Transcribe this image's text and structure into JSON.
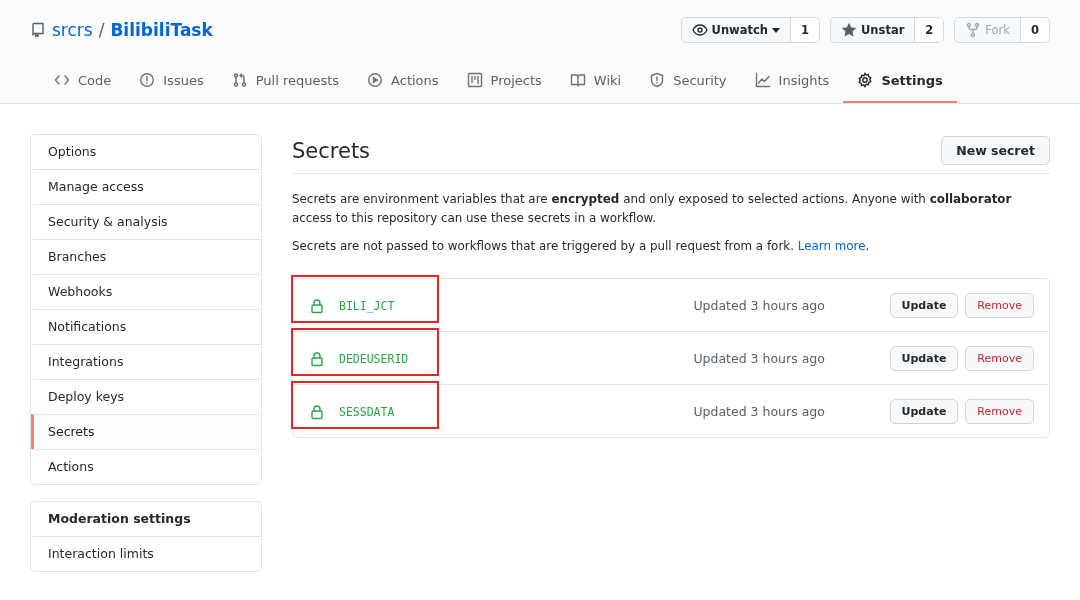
{
  "repo": {
    "owner": "srcrs",
    "separator": "/",
    "name": "BilibiliTask"
  },
  "actions": [
    {
      "kind": "watch",
      "label": "Unwatch",
      "count": "1"
    },
    {
      "kind": "star",
      "label": "Unstar",
      "count": "2"
    },
    {
      "kind": "fork",
      "label": "Fork",
      "count": "0",
      "disabled": true
    }
  ],
  "tabs": [
    {
      "kind": "code",
      "label": "Code",
      "selected": false
    },
    {
      "kind": "issues",
      "label": "Issues",
      "selected": false
    },
    {
      "kind": "pulls",
      "label": "Pull requests",
      "selected": false
    },
    {
      "kind": "actions",
      "label": "Actions",
      "selected": false
    },
    {
      "kind": "projects",
      "label": "Projects",
      "selected": false
    },
    {
      "kind": "wiki",
      "label": "Wiki",
      "selected": false
    },
    {
      "kind": "security",
      "label": "Security",
      "selected": false
    },
    {
      "kind": "insights",
      "label": "Insights",
      "selected": false
    },
    {
      "kind": "settings",
      "label": "Settings",
      "selected": true
    }
  ],
  "sidebar": {
    "items": [
      {
        "label": "Options",
        "selected": false
      },
      {
        "label": "Manage access",
        "selected": false
      },
      {
        "label": "Security & analysis",
        "selected": false
      },
      {
        "label": "Branches",
        "selected": false
      },
      {
        "label": "Webhooks",
        "selected": false
      },
      {
        "label": "Notifications",
        "selected": false
      },
      {
        "label": "Integrations",
        "selected": false
      },
      {
        "label": "Deploy keys",
        "selected": false
      },
      {
        "label": "Secrets",
        "selected": true
      },
      {
        "label": "Actions",
        "selected": false
      }
    ]
  },
  "moderation": {
    "heading": "Moderation settings",
    "items": [
      {
        "label": "Interaction limits",
        "selected": false
      }
    ]
  },
  "main": {
    "title": "Secrets",
    "new_button": "New secret",
    "description": "Secrets are environment variables that are **encrypted** and only exposed to selected actions. Anyone with **collaborator** access to this repository can use these secrets in a workflow.",
    "note": "Secrets are not passed to workflows that are triggered by a pull request from a fork.",
    "note_link": "Learn more",
    "note_end": ".",
    "secrets": [
      {
        "name": "BILI_JCT",
        "updated": "Updated 3 hours ago",
        "update": "Update",
        "remove": "Remove",
        "highlighted": true
      },
      {
        "name": "DEDEUSERID",
        "updated": "Updated 3 hours ago",
        "update": "Update",
        "remove": "Remove",
        "highlighted": true
      },
      {
        "name": "SESSDATA",
        "updated": "Updated 3 hours ago",
        "update": "Update",
        "remove": "Remove",
        "highlighted": true
      }
    ]
  }
}
